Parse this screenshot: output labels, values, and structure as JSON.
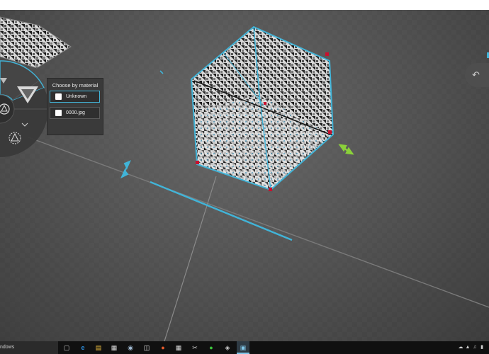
{
  "app": {
    "name": "3D Builder"
  },
  "material_menu": {
    "title": "Choose by material",
    "items": [
      {
        "label": "Unknown",
        "selected": true
      },
      {
        "label": "0000.jpg",
        "selected": false
      }
    ]
  },
  "taskbar": {
    "search_text": "ndows",
    "icons": [
      "task-view-icon",
      "edge-icon",
      "file-explorer-icon",
      "store-icon",
      "steam-icon",
      "media-icon",
      "paint-icon",
      "calculator-icon",
      "snipping-icon",
      "xbox-icon",
      "app-icon",
      "3d-builder-icon"
    ],
    "tray_icons": [
      "onedrive-icon",
      "network-icon",
      "volume-icon",
      "battery-icon"
    ]
  },
  "colors": {
    "accent": "#41b4d8",
    "viewport_bg": "#565656",
    "taskbar_bg": "#101010",
    "panel_bg": "#3a3a3a",
    "green_handle": "#8bd13a",
    "red_marker": "#c8102e"
  }
}
